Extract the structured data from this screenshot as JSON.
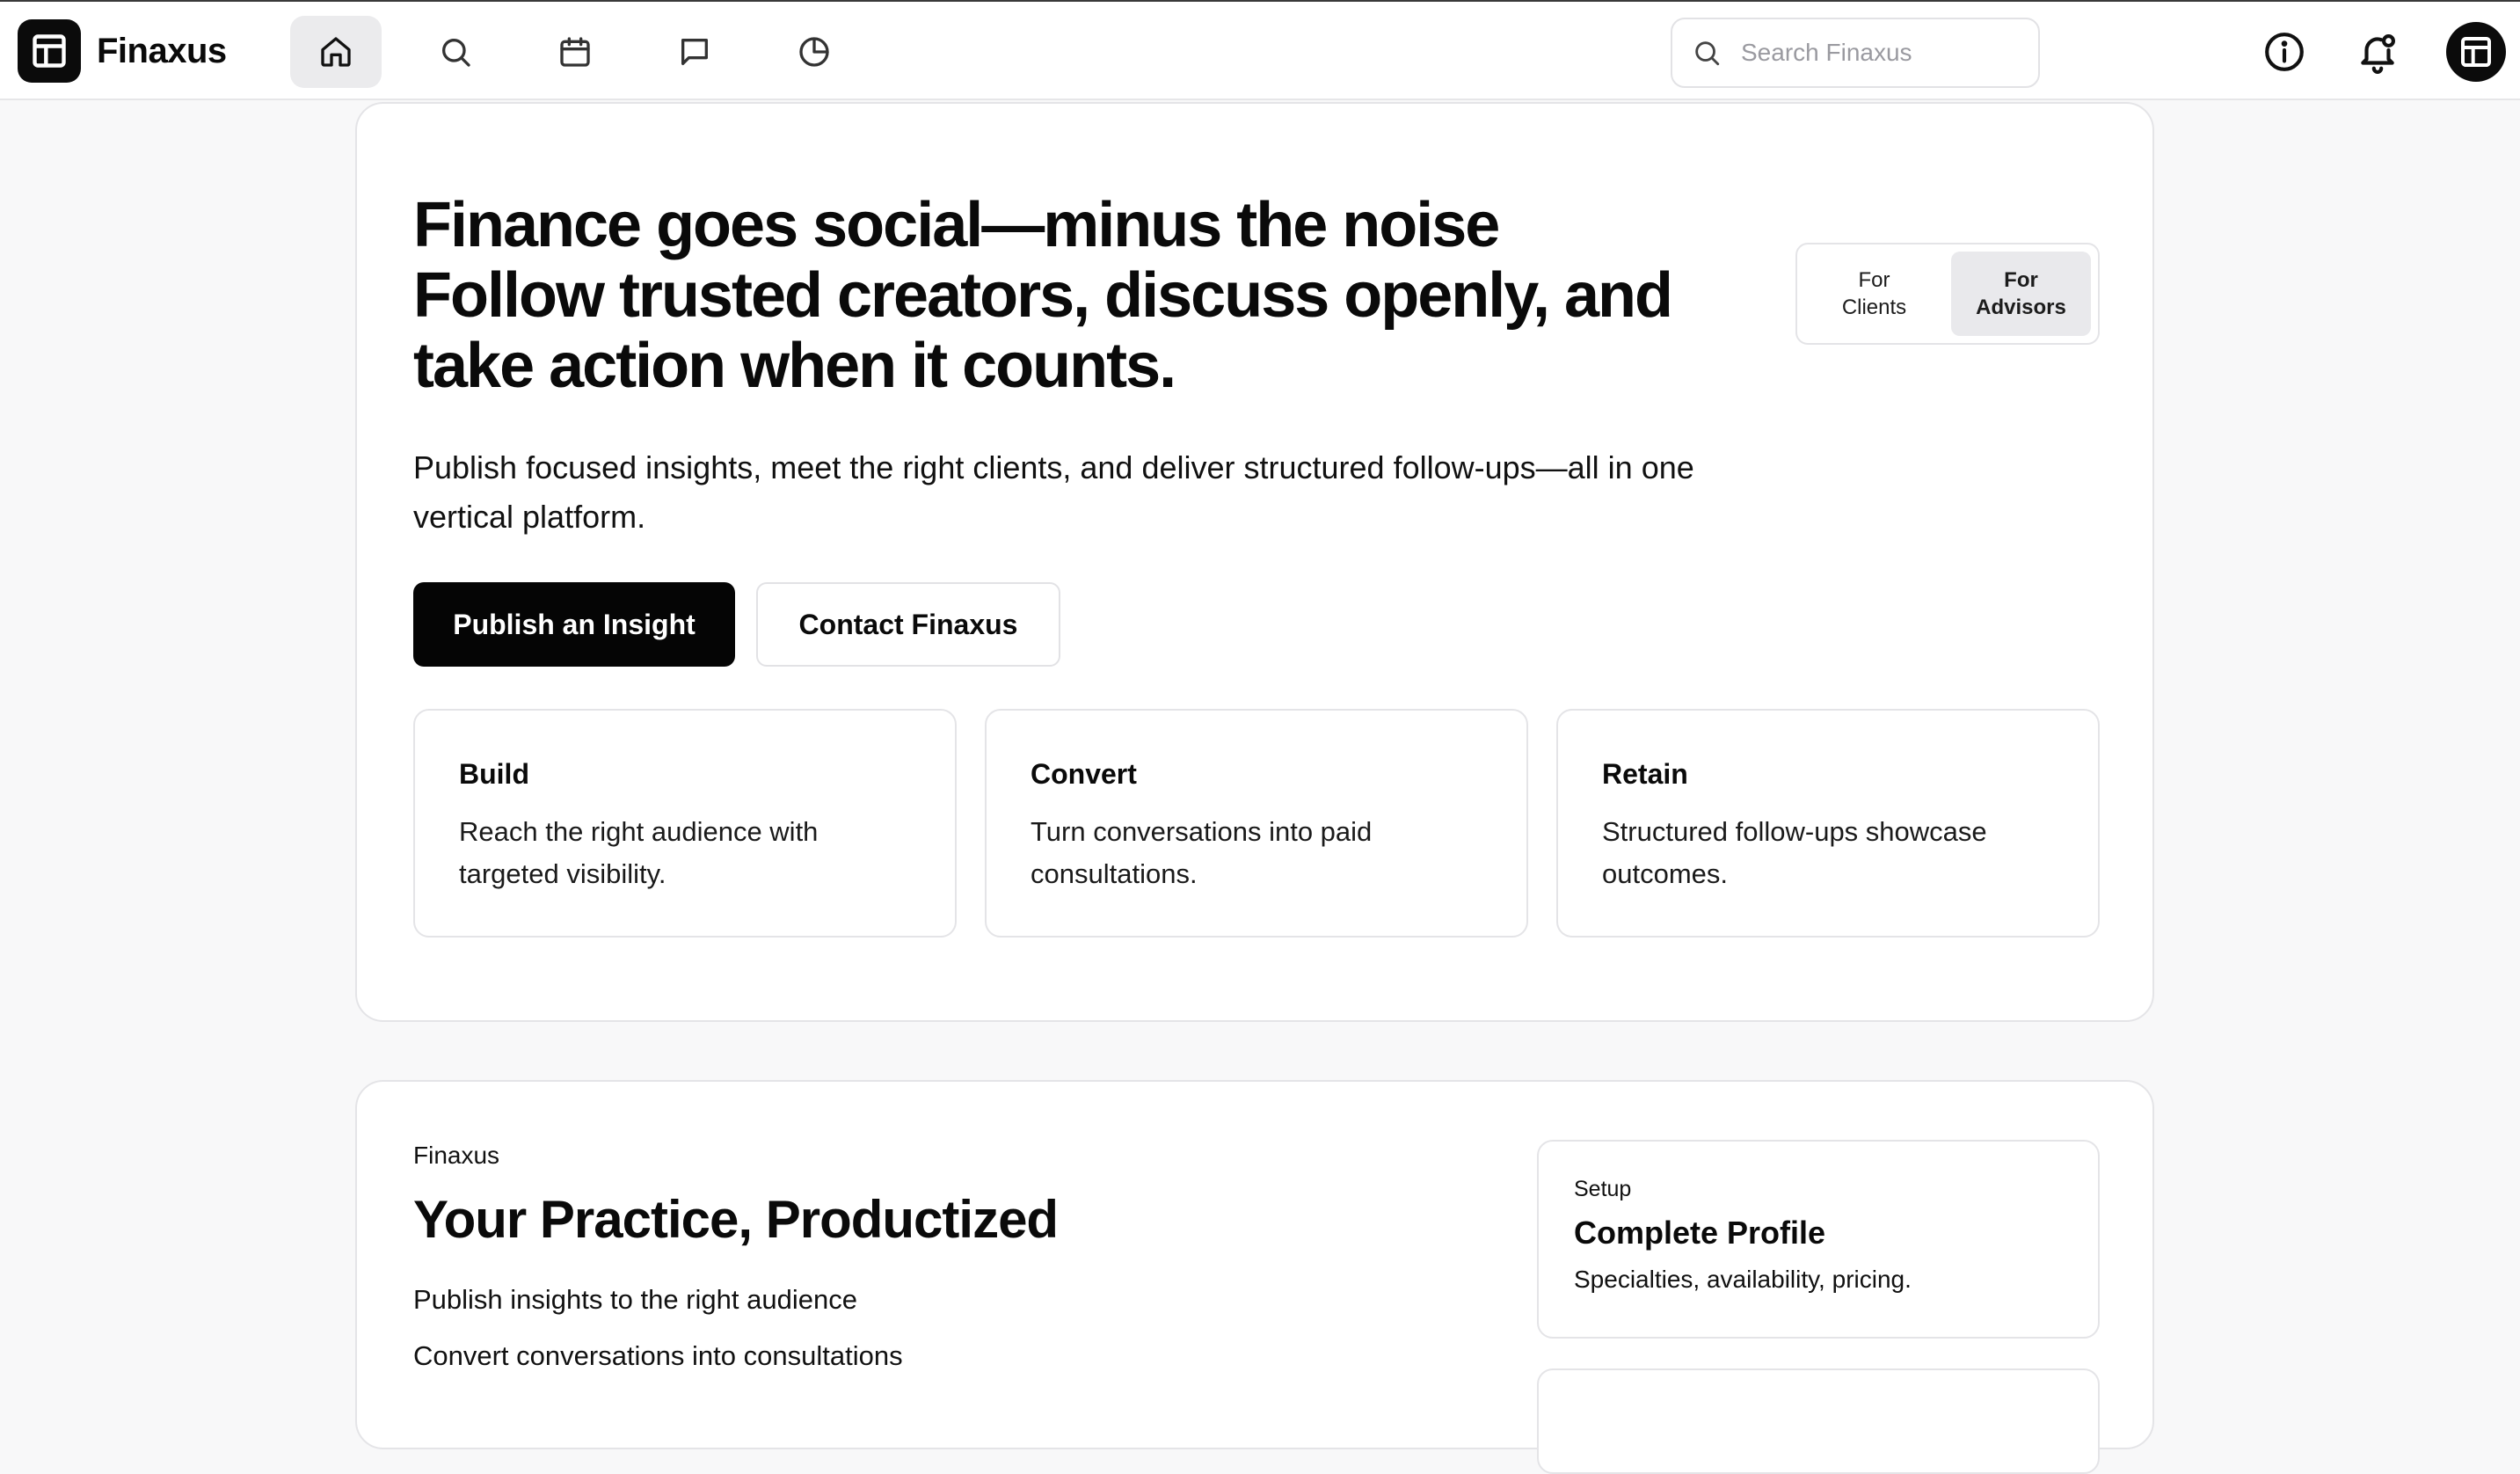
{
  "brand": {
    "name": "Finaxus"
  },
  "nav": {
    "items": [
      {
        "id": "home",
        "icon": "home-icon",
        "active": true
      },
      {
        "id": "search",
        "icon": "search-icon",
        "active": false
      },
      {
        "id": "calendar",
        "icon": "calendar-icon",
        "active": false
      },
      {
        "id": "messages",
        "icon": "message-icon",
        "active": false
      },
      {
        "id": "analytics",
        "icon": "pie-chart-icon",
        "active": false
      }
    ]
  },
  "search": {
    "placeholder": "Search Finaxus",
    "value": ""
  },
  "header_icons": [
    "info-icon",
    "notification-bell-icon",
    "profile-avatar"
  ],
  "hero": {
    "title_lines": [
      "Finance goes social—minus the noise",
      "Follow trusted creators, discuss openly, and",
      "take action when it counts."
    ],
    "subtitle": "Publish focused insights, meet the right clients, and deliver structured follow-ups—all in one vertical platform.",
    "audience_toggle": {
      "options": [
        {
          "label": "For\nClients",
          "active": false
        },
        {
          "label": "For\nAdvisors",
          "active": true
        }
      ]
    },
    "primary_cta": "Publish an Insight",
    "secondary_cta": "Contact Finaxus",
    "features": [
      {
        "title": "Build",
        "description": "Reach the right audience with targeted visibility."
      },
      {
        "title": "Convert",
        "description": "Turn conversations into paid consultations."
      },
      {
        "title": "Retain",
        "description": "Structured follow-ups showcase outcomes."
      }
    ]
  },
  "practice": {
    "eyebrow": "Finaxus",
    "title": "Your Practice, Productized",
    "bullets": [
      "Publish insights to the right audience",
      "Convert conversations into consultations"
    ],
    "setup_card": {
      "eyebrow": "Setup",
      "title": "Complete Profile",
      "description": "Specialties, availability, pricing."
    }
  },
  "colors": {
    "background": "#f8f8f9",
    "surface": "#ffffff",
    "primary": "#050505",
    "border": "#e4e4e7",
    "active_tab": "#e9e9ec"
  }
}
